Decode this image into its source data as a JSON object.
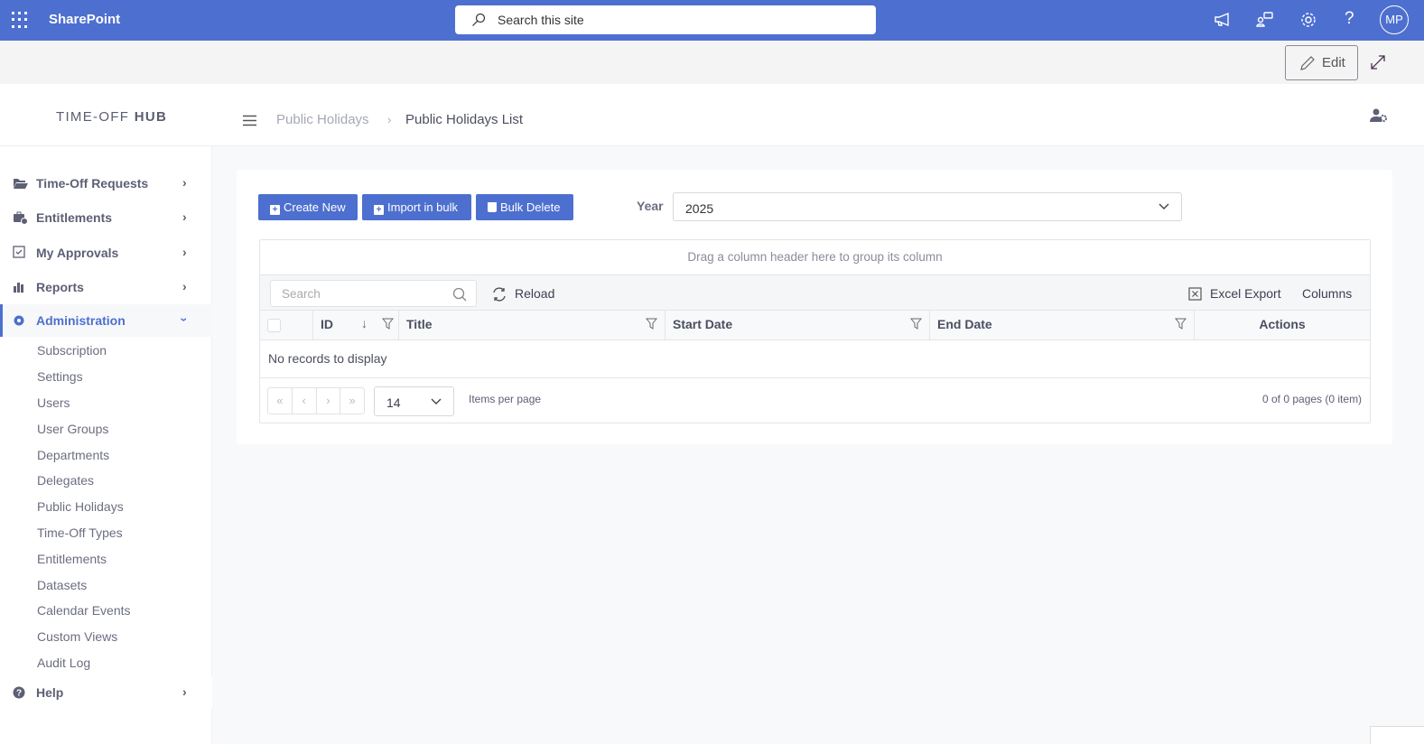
{
  "topbar": {
    "brand": "SharePoint",
    "search_placeholder": "Search this site",
    "avatar": "MP",
    "icons": [
      "megaphone-icon",
      "chat-icon",
      "gear-icon",
      "help-icon"
    ],
    "accent": "#4d6fcf"
  },
  "commandbar": {
    "edit_label": "Edit"
  },
  "header": {
    "logo_light": "TIME-OFF ",
    "logo_bold": "HUB",
    "breadcrumb": [
      "Public Holidays",
      "Public Holidays List"
    ],
    "separator": "›"
  },
  "sidebar": {
    "items": [
      {
        "label": "Time-Off Requests",
        "icon": "folder-open-icon"
      },
      {
        "label": "Entitlements",
        "icon": "briefcase-clock-icon"
      },
      {
        "label": "My Approvals",
        "icon": "checkbox-icon"
      },
      {
        "label": "Reports",
        "icon": "bar-chart-icon"
      },
      {
        "label": "Administration",
        "icon": "gear-icon",
        "active": true
      }
    ],
    "subitems": [
      "Subscription",
      "Settings",
      "Users",
      "User Groups",
      "Departments",
      "Delegates",
      "Public Holidays",
      "Time-Off Types",
      "Entitlements",
      "Datasets",
      "Calendar Events",
      "Custom Views",
      "Audit Log"
    ],
    "help": "Help"
  },
  "actions": {
    "create": "Create New",
    "import": "Import in bulk",
    "delete": "Bulk Delete"
  },
  "year": {
    "label": "Year",
    "value": "2025"
  },
  "grid": {
    "group_hint": "Drag a column header here to group its column",
    "search_placeholder": "Search",
    "reload": "Reload",
    "excel": "Excel Export",
    "columns_btn": "Columns",
    "columns": [
      "ID",
      "Title",
      "Start Date",
      "End Date",
      "Actions"
    ],
    "empty": "No records to display",
    "pager": [
      "«",
      "‹",
      "›",
      "»"
    ],
    "page_size": "14",
    "items_per_page": "Items per page",
    "page_info": "0 of 0 pages (0 item)"
  }
}
